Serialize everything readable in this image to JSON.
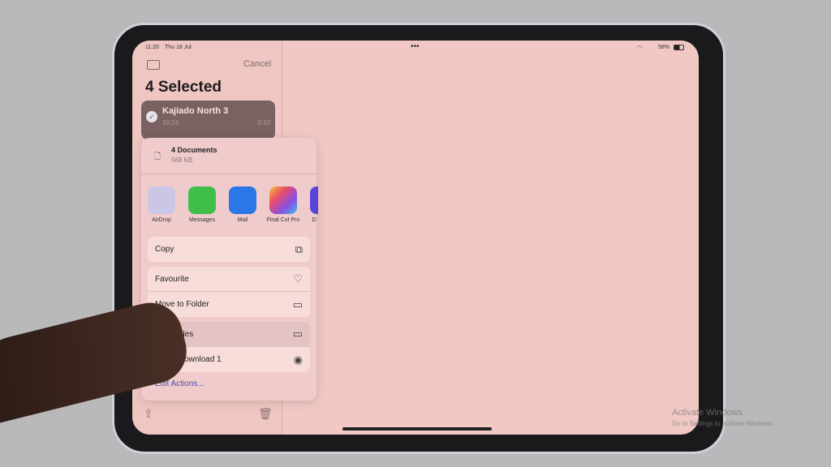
{
  "status": {
    "time": "11:20",
    "date": "Thu 18 Jul",
    "battery": "58%"
  },
  "sidebar": {
    "cancel": "Cancel",
    "title": "4 Selected",
    "item": {
      "name": "Kajiado North 3",
      "time": "10:24",
      "duration": "0:10"
    }
  },
  "share": {
    "header": {
      "title": "4 Documents",
      "size": "568 KB"
    },
    "apps": [
      {
        "label": "AirDrop",
        "color": "#c9c6e6"
      },
      {
        "label": "Messages",
        "color": "#3fbf4a"
      },
      {
        "label": "Mail",
        "color": "#2a78e6"
      },
      {
        "label": "Final Cut Pro",
        "color": "#e94d6a"
      },
      {
        "label": "D",
        "color": "#5a45d8"
      }
    ],
    "actions": {
      "copy": "Copy",
      "favourite": "Favourite",
      "move": "Move to Folder",
      "save": "to Files",
      "lucky": "Lucky Download 1"
    },
    "edit": "Edit Actions..."
  },
  "watermark": {
    "line1": "Activate Windows",
    "line2": "Go to Settings to activate Windows"
  }
}
